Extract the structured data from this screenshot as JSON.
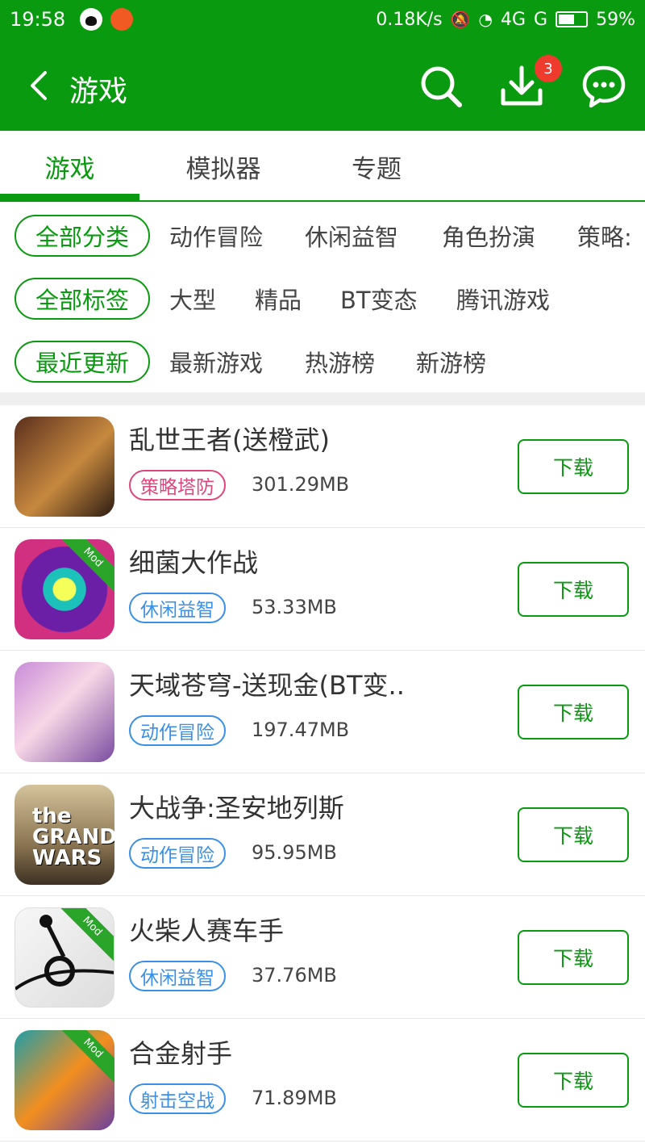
{
  "status": {
    "time": "19:58",
    "net_speed": "0.18K/s",
    "network": "4G",
    "network2": "G",
    "battery": "59%",
    "battery_level": 0.59
  },
  "header": {
    "title": "游戏",
    "download_badge": "3"
  },
  "tabs": [
    {
      "label": "游戏",
      "active": true
    },
    {
      "label": "模拟器",
      "active": false
    },
    {
      "label": "专题",
      "active": false
    }
  ],
  "filters": {
    "category": {
      "selected": "全部分类",
      "options": [
        "动作冒险",
        "休闲益智",
        "角色扮演",
        "策略:"
      ]
    },
    "tags": {
      "selected": "全部标签",
      "options": [
        "大型",
        "精品",
        "BT变态",
        "腾讯游戏"
      ]
    },
    "sort": {
      "selected": "最近更新",
      "options": [
        "最新游戏",
        "热游榜",
        "新游榜"
      ]
    }
  },
  "apps": [
    {
      "name": "乱世王者(送橙武)",
      "tag": "策略塔防",
      "tag_color": "#e0457b",
      "size": "301.29MB",
      "button": "下载",
      "mod": false
    },
    {
      "name": "细菌大作战",
      "tag": "休闲益智",
      "tag_color": "#3a8fe6",
      "size": "53.33MB",
      "button": "下载",
      "mod": true,
      "mod_label": "Mod"
    },
    {
      "name": "天域苍穹-送现金(BT变..",
      "tag": "动作冒险",
      "tag_color": "#3a8fe6",
      "size": "197.47MB",
      "button": "下载",
      "mod": false
    },
    {
      "name": "大战争:圣安地列斯",
      "tag": "动作冒险",
      "tag_color": "#3a8fe6",
      "size": "95.95MB",
      "button": "下载",
      "mod": false,
      "icon_text": "the GRAND WARS"
    },
    {
      "name": "火柴人赛车手",
      "tag": "休闲益智",
      "tag_color": "#3a8fe6",
      "size": "37.76MB",
      "button": "下载",
      "mod": true,
      "mod_label": "Mod"
    },
    {
      "name": "合金射手",
      "tag": "射击空战",
      "tag_color": "#3a8fe6",
      "size": "71.89MB",
      "button": "下载",
      "mod": true,
      "mod_label": "Mod"
    }
  ],
  "colors": {
    "brand": "#0a9a10",
    "badge": "#ef3b2d"
  }
}
